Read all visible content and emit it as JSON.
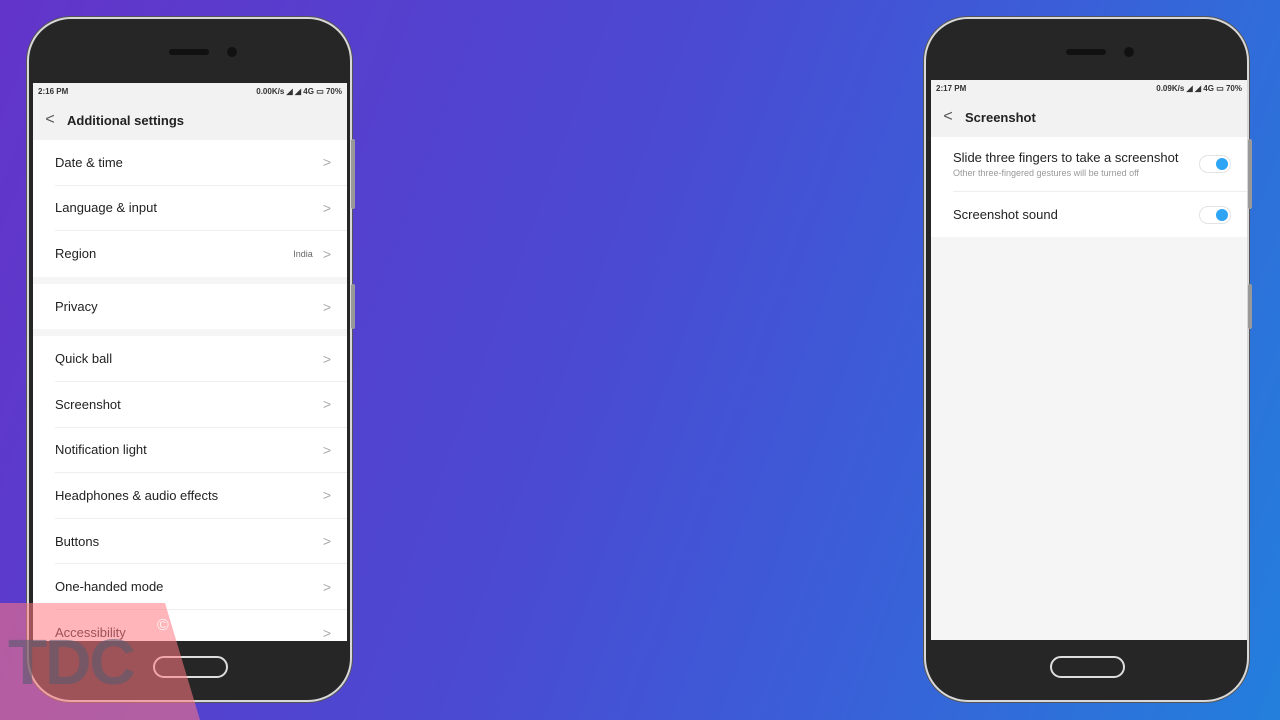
{
  "left_phone": {
    "status": {
      "time": "2:16 PM",
      "speed": "0.00K/s",
      "network": "4G",
      "battery": "70%"
    },
    "title": "Additional settings",
    "groups": [
      [
        {
          "label": "Date & time"
        },
        {
          "label": "Language & input"
        },
        {
          "label": "Region",
          "value": "India"
        }
      ],
      [
        {
          "label": "Privacy"
        }
      ],
      [
        {
          "label": "Quick ball"
        },
        {
          "label": "Screenshot"
        },
        {
          "label": "Notification light"
        },
        {
          "label": "Headphones & audio effects"
        },
        {
          "label": "Buttons"
        },
        {
          "label": "One-handed mode"
        },
        {
          "label": "Accessibility"
        }
      ]
    ]
  },
  "right_phone": {
    "status": {
      "time": "2:17 PM",
      "speed": "0.09K/s",
      "network": "4G",
      "battery": "70%"
    },
    "title": "Screenshot",
    "items": [
      {
        "label": "Slide three fingers to take a screenshot",
        "sub": "Other three-fingered gestures will be turned off",
        "on": true
      },
      {
        "label": "Screenshot sound",
        "on": true
      }
    ]
  },
  "watermark": {
    "text": "TDC",
    "symbol": "©"
  },
  "colors": {
    "toggle_on": "#2ea4f5"
  }
}
